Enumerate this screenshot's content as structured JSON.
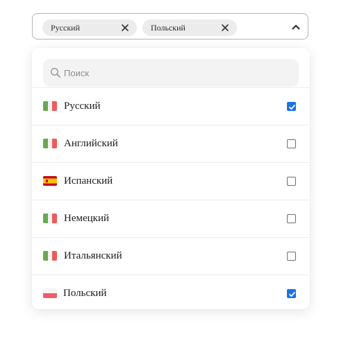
{
  "select": {
    "chips": [
      {
        "label": "Русский",
        "remove_icon": "close-icon"
      },
      {
        "label": "Польский",
        "remove_icon": "close-icon"
      }
    ],
    "toggle_icon": "chevron-up-icon"
  },
  "dropdown": {
    "search": {
      "icon": "search-icon",
      "placeholder": "Поиск",
      "value": ""
    },
    "options": [
      {
        "label": "Русский",
        "flag": "flag-italy-icon",
        "checked": true
      },
      {
        "label": "Английский",
        "flag": "flag-italy-icon",
        "checked": false
      },
      {
        "label": "Испанский",
        "flag": "flag-spain-icon",
        "checked": false
      },
      {
        "label": "Немецкий",
        "flag": "flag-italy-icon",
        "checked": false
      },
      {
        "label": "Итальянский",
        "flag": "flag-italy-icon",
        "checked": false
      },
      {
        "label": "Польский",
        "flag": "flag-poland-icon",
        "checked": true
      }
    ]
  },
  "colors": {
    "accent": "#1a73e8",
    "chip_bg": "#ececec",
    "search_bg": "#f3f3f3",
    "flag_green": "#6aa84f",
    "flag_red": "#f05a5a",
    "flag_spain_red": "#c60b1e",
    "flag_spain_yellow": "#ffc400"
  }
}
